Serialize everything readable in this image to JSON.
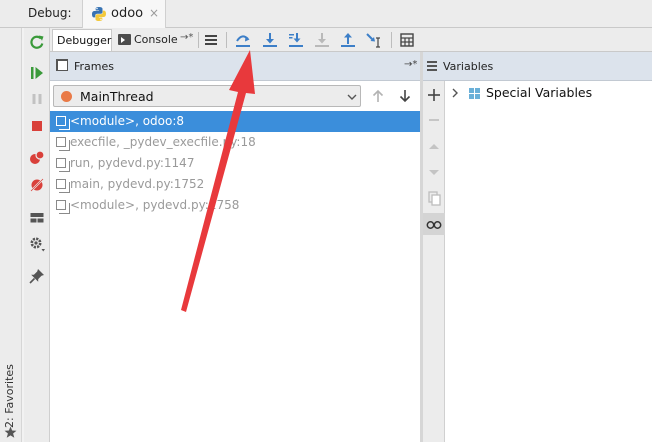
{
  "debug_bar": {
    "label": "Debug:",
    "session_tab": {
      "name": "odoo",
      "close": "×"
    }
  },
  "tabs": {
    "debugger": "Debugger",
    "console": "Console",
    "console_pin": "→*"
  },
  "toolbar": {
    "buttons": [
      "show-execution-point",
      "step-over",
      "step-into",
      "step-into-my-code",
      "force-step-into",
      "step-out",
      "run-to-cursor",
      "evaluate-expression"
    ]
  },
  "frames": {
    "title": "Frames",
    "pin": "→*",
    "thread": {
      "name": "MainThread",
      "color": "#e97a47"
    },
    "items": [
      {
        "label": "<module>, odoo:8",
        "selected": true
      },
      {
        "label": "execfile, _pydev_execfile.py:18",
        "selected": false
      },
      {
        "label": "run, pydevd.py:1147",
        "selected": false
      },
      {
        "label": "main, pydevd.py:1752",
        "selected": false
      },
      {
        "label": "<module>, pydevd.py:1758",
        "selected": false
      }
    ]
  },
  "variables": {
    "title": "Variables",
    "items": [
      {
        "label": "Special Variables"
      }
    ]
  },
  "favorites": {
    "label": "2: Favorites"
  },
  "colors": {
    "selection": "#3b8edb",
    "header_bg": "#dce3ec",
    "annotation_arrow": "#e8393c",
    "step_icon": "#3d7fc8"
  }
}
